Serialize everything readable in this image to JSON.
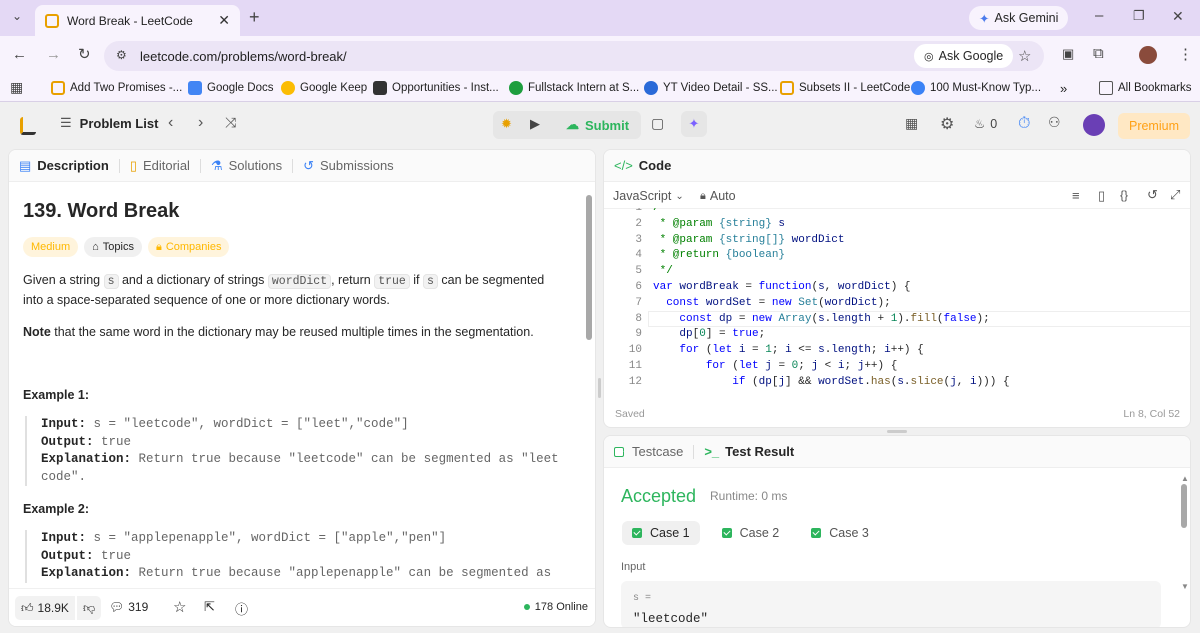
{
  "browser": {
    "tab_title": "Word Break - LeetCode",
    "url": "leetcode.com/problems/word-break/",
    "ask_gemini": "Ask Gemini",
    "ask_google": "Ask Google",
    "bookmarks": [
      "Add Two Promises -...",
      "Google Docs",
      "Google Keep",
      "Opportunities - Inst...",
      "Fullstack Intern at S...",
      "YT Video Detail - SS...",
      "Subsets II - LeetCode",
      "100 Must-Know Typ..."
    ],
    "all_bookmarks": "All Bookmarks",
    "more": "»"
  },
  "nav": {
    "problem_list": "Problem List",
    "submit": "Submit",
    "streak": "0",
    "premium": "Premium"
  },
  "desc": {
    "tabs": [
      "Description",
      "Editorial",
      "Solutions",
      "Submissions"
    ],
    "title": "139. Word Break",
    "difficulty": "Medium",
    "topics": "Topics",
    "companies": "Companies",
    "p1_a": "Given a string ",
    "p1_s": "s",
    "p1_b": " and a dictionary of strings ",
    "p1_wd": "wordDict",
    "p1_c": ", return ",
    "p1_true": "true",
    "p1_d": " if ",
    "p1_s2": "s",
    "p1_e": " can be segmented into a space-separated sequence of one or more dictionary words.",
    "note_b": "Note",
    "note_rest": " that the same word in the dictionary may be reused multiple times in the segmentation.",
    "ex1_title": "Example 1:",
    "ex1_input_l": "Input:",
    "ex1_input": " s = \"leetcode\", wordDict = [\"leet\",\"code\"]",
    "ex1_output_l": "Output:",
    "ex1_output": " true",
    "ex1_expl_l": "Explanation:",
    "ex1_expl": " Return true because \"leetcode\" can be segmented as \"leet code\".",
    "ex2_title": "Example 2:",
    "ex2_input_l": "Input:",
    "ex2_input": " s = \"applepenapple\", wordDict = [\"apple\",\"pen\"]",
    "ex2_output_l": "Output:",
    "ex2_output": " true",
    "ex2_expl_l": "Explanation:",
    "ex2_expl": " Return true because \"applepenapple\" can be segmented as",
    "likes": "18.9K",
    "comments": "319",
    "online": "178 Online"
  },
  "code": {
    "title": "Code",
    "language": "JavaScript",
    "mode": "Auto",
    "saved": "Saved",
    "cursor": "Ln 8, Col 52"
  },
  "result": {
    "tab_testcase": "Testcase",
    "tab_result": "Test Result",
    "status": "Accepted",
    "runtime": "Runtime: 0 ms",
    "cases": [
      "Case 1",
      "Case 2",
      "Case 3"
    ],
    "input_label": "Input",
    "var_label": "s =",
    "var_value": "\"leetcode\""
  },
  "colors": {
    "accepted": "#2db55d",
    "medium": "#ffb800",
    "submit": "#2db55d",
    "premium": "#ffa116",
    "browser_frame": "#e4d9f5"
  }
}
